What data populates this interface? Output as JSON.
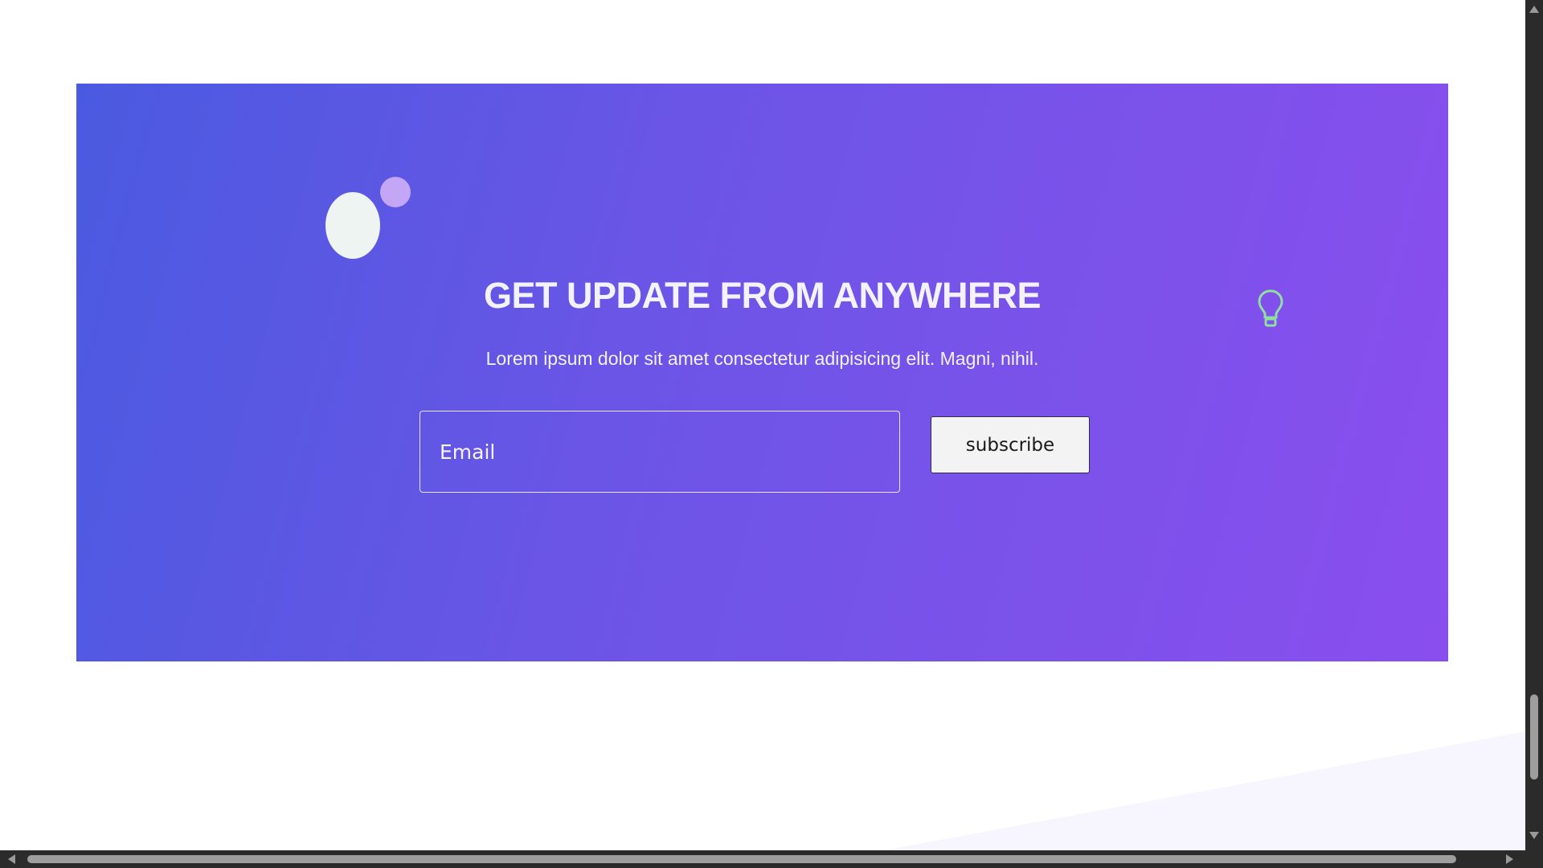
{
  "newsletter": {
    "title": "GET UPDATE FROM ANYWHERE",
    "subtitle": "Lorem ipsum dolor sit amet consectetur adipisicing elit. Magni, nihil.",
    "email_placeholder": "Email",
    "email_value": "",
    "subscribe_label": "subscribe"
  },
  "icons": {
    "decorative_blob_large": "blob-shape",
    "decorative_blob_small": "circle-shape",
    "bulb": "lightbulb-icon"
  },
  "colors": {
    "gradient_start": "#4a5ae0",
    "gradient_end": "#8a4eee",
    "bulb_stroke": "#8fe0a0",
    "blob_large": "#eef4f2",
    "blob_small": "#c3a6f5"
  }
}
